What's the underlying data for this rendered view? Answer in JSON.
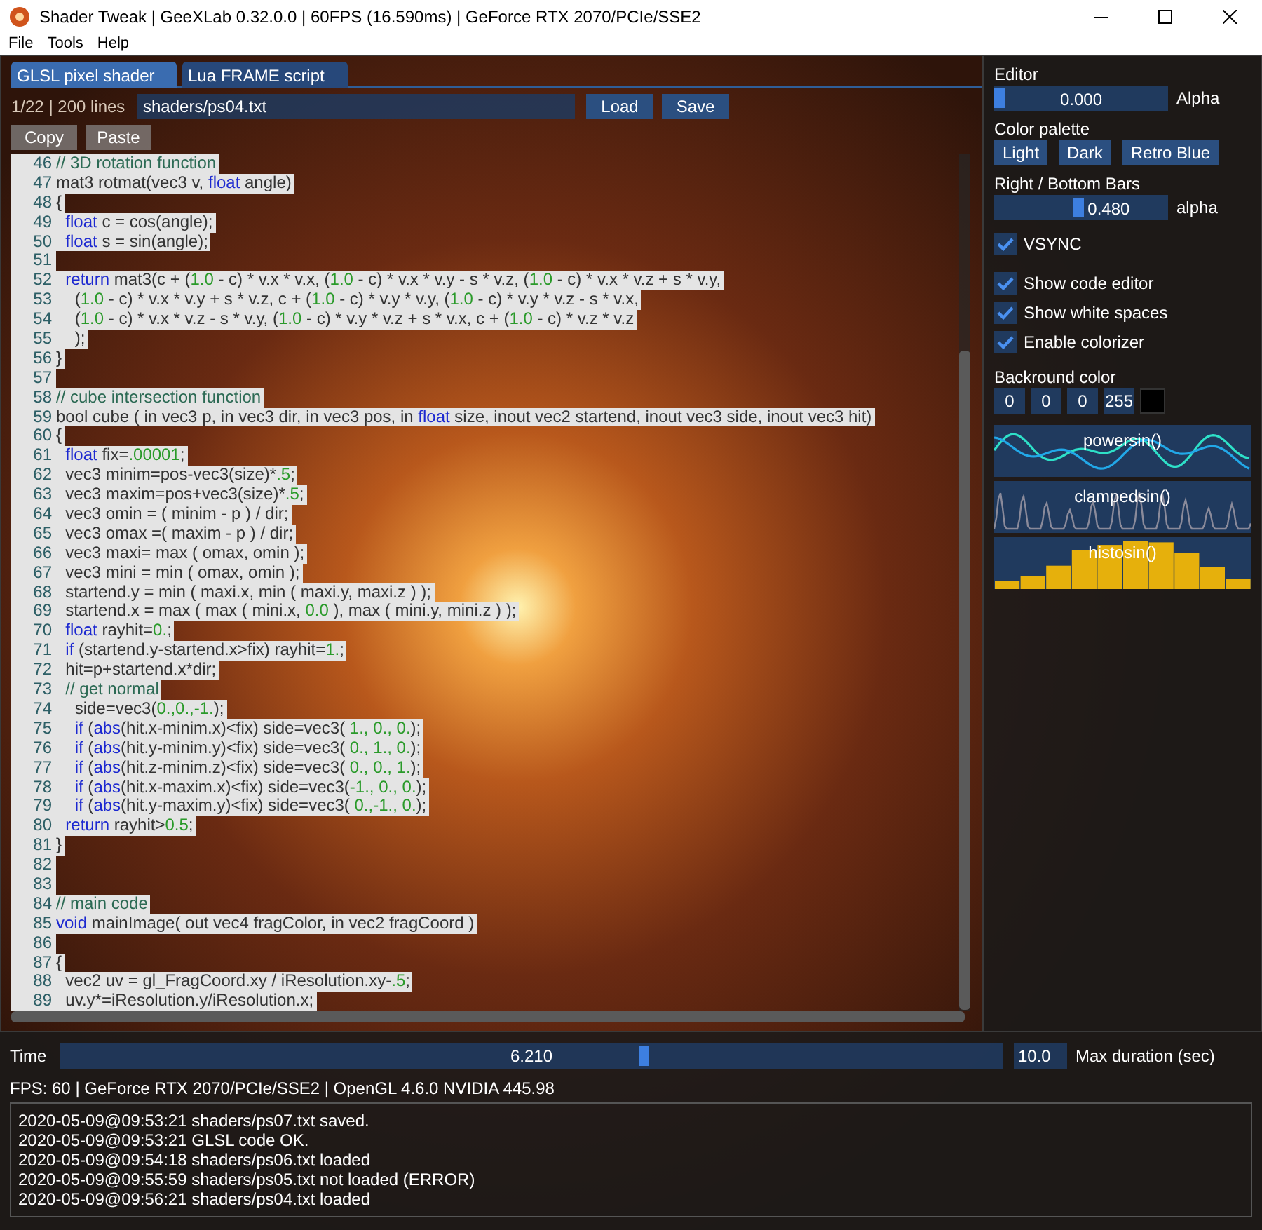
{
  "window": {
    "title": "Shader Tweak | GeeXLab 0.32.0.0 | 60FPS (16.590ms) | GeForce RTX 2070/PCIe/SSE2"
  },
  "menu": [
    "File",
    "Tools",
    "Help"
  ],
  "tabs": [
    {
      "label": "GLSL pixel shader",
      "selected": true
    },
    {
      "label": "Lua FRAME script",
      "selected": false
    }
  ],
  "editor": {
    "info": "1/22 | 200 lines",
    "path": "shaders/ps04.txt",
    "buttons": [
      "Load",
      "Save"
    ],
    "clipboard_buttons": [
      "Copy",
      "Paste"
    ],
    "lines": [
      {
        "n": "46",
        "parts": [
          {
            "t": "// 3D rotation function",
            "kind": "comment"
          }
        ]
      },
      {
        "n": "47",
        "parts": [
          {
            "t": "mat3 rotmat(vec3 v, "
          },
          {
            "t": "float",
            "kind": "keyword"
          },
          {
            "t": " angle)"
          }
        ]
      },
      {
        "n": "48",
        "parts": [
          {
            "t": "{"
          }
        ]
      },
      {
        "n": "49",
        "parts": [
          {
            "t": "  float",
            "kind": "keyword"
          },
          {
            "t": " c = cos(angle);"
          }
        ]
      },
      {
        "n": "50",
        "parts": [
          {
            "t": "  float",
            "kind": "keyword"
          },
          {
            "t": " s = sin(angle);"
          }
        ]
      },
      {
        "n": "51"
      },
      {
        "n": "52",
        "parts": [
          {
            "t": "  return",
            "kind": "keyword"
          },
          {
            "t": " mat3(c + ("
          },
          {
            "t": "1.0",
            "kind": "number"
          },
          {
            "t": " - c) * v.x * v.x, ("
          },
          {
            "t": "1.0",
            "kind": "number"
          },
          {
            "t": " - c) * v.x * v.y - s * v.z, ("
          },
          {
            "t": "1.0",
            "kind": "number"
          },
          {
            "t": " - c) * v.x * v.z + s * v.y,"
          }
        ]
      },
      {
        "n": "53",
        "parts": [
          {
            "t": "    ("
          },
          {
            "t": "1.0",
            "kind": "number"
          },
          {
            "t": " - c) * v.x * v.y + s * v.z, c + ("
          },
          {
            "t": "1.0",
            "kind": "number"
          },
          {
            "t": " - c) * v.y * v.y, ("
          },
          {
            "t": "1.0",
            "kind": "number"
          },
          {
            "t": " - c) * v.y * v.z - s * v.x,"
          }
        ]
      },
      {
        "n": "54",
        "parts": [
          {
            "t": "    ("
          },
          {
            "t": "1.0",
            "kind": "number"
          },
          {
            "t": " - c) * v.x * v.z - s * v.y, ("
          },
          {
            "t": "1.0",
            "kind": "number"
          },
          {
            "t": " - c) * v.y * v.z + s * v.x, c + ("
          },
          {
            "t": "1.0",
            "kind": "number"
          },
          {
            "t": " - c) * v.z * v.z"
          }
        ]
      },
      {
        "n": "55",
        "parts": [
          {
            "t": "    );"
          }
        ]
      },
      {
        "n": "56",
        "parts": [
          {
            "t": "}"
          }
        ]
      },
      {
        "n": "57"
      },
      {
        "n": "58",
        "parts": [
          {
            "t": "// cube intersection function",
            "kind": "comment"
          }
        ]
      },
      {
        "n": "59",
        "parts": [
          {
            "t": "bool cube ( in vec3 p, in vec3 dir, in vec3 pos, in "
          },
          {
            "t": "float",
            "kind": "keyword"
          },
          {
            "t": " size, inout vec2 startend, inout vec3 side, inout vec3 hit)"
          }
        ]
      },
      {
        "n": "60",
        "parts": [
          {
            "t": "{"
          }
        ]
      },
      {
        "n": "61",
        "parts": [
          {
            "t": "  float",
            "kind": "keyword"
          },
          {
            "t": " fix="
          },
          {
            "t": ".00001",
            "kind": "number"
          },
          {
            "t": ";"
          }
        ]
      },
      {
        "n": "62",
        "parts": [
          {
            "t": "  vec3 minim=pos-vec3(size)*"
          },
          {
            "t": ".5",
            "kind": "number"
          },
          {
            "t": ";"
          }
        ]
      },
      {
        "n": "63",
        "parts": [
          {
            "t": "  vec3 maxim=pos+vec3(size)*"
          },
          {
            "t": ".5",
            "kind": "number"
          },
          {
            "t": ";"
          }
        ]
      },
      {
        "n": "64",
        "parts": [
          {
            "t": "  vec3 omin = ( minim - p ) / dir;"
          }
        ]
      },
      {
        "n": "65",
        "parts": [
          {
            "t": "  vec3 omax =( maxim - p ) / dir;"
          }
        ]
      },
      {
        "n": "66",
        "parts": [
          {
            "t": "  vec3 maxi= max ( omax, omin );"
          }
        ]
      },
      {
        "n": "67",
        "parts": [
          {
            "t": "  vec3 mini = min ( omax, omin );"
          }
        ]
      },
      {
        "n": "68",
        "parts": [
          {
            "t": "  startend.y = min ( maxi.x, min ( maxi.y, maxi.z ) );"
          }
        ]
      },
      {
        "n": "69",
        "parts": [
          {
            "t": "  startend.x = max ( max ( mini.x, "
          },
          {
            "t": "0.0",
            "kind": "number"
          },
          {
            "t": " ), max ( mini.y, mini.z ) );"
          }
        ]
      },
      {
        "n": "70",
        "parts": [
          {
            "t": "  float",
            "kind": "keyword"
          },
          {
            "t": " rayhit="
          },
          {
            "t": "0.",
            "kind": "number"
          },
          {
            "t": ";"
          }
        ]
      },
      {
        "n": "71",
        "parts": [
          {
            "t": "  if",
            "kind": "keyword"
          },
          {
            "t": " (startend.y-startend.x>fix) rayhit="
          },
          {
            "t": "1.",
            "kind": "number"
          },
          {
            "t": ";"
          }
        ]
      },
      {
        "n": "72",
        "parts": [
          {
            "t": "  hit=p+startend.x*dir;"
          }
        ]
      },
      {
        "n": "73",
        "parts": [
          {
            "t": "  // get normal",
            "kind": "comment"
          }
        ]
      },
      {
        "n": "74",
        "parts": [
          {
            "t": "    side=vec3("
          },
          {
            "t": "0.,0.,-1.",
            "kind": "number"
          },
          {
            "t": ");"
          }
        ]
      },
      {
        "n": "75",
        "parts": [
          {
            "t": "    if",
            "kind": "keyword"
          },
          {
            "t": " ("
          },
          {
            "t": "abs",
            "kind": "keyword"
          },
          {
            "t": "(hit.x-minim.x)<fix) side=vec3( "
          },
          {
            "t": "1., 0., 0.",
            "kind": "number"
          },
          {
            "t": ");"
          }
        ]
      },
      {
        "n": "76",
        "parts": [
          {
            "t": "    if",
            "kind": "keyword"
          },
          {
            "t": " ("
          },
          {
            "t": "abs",
            "kind": "keyword"
          },
          {
            "t": "(hit.y-minim.y)<fix) side=vec3( "
          },
          {
            "t": "0., 1., 0.",
            "kind": "number"
          },
          {
            "t": ");"
          }
        ]
      },
      {
        "n": "77",
        "parts": [
          {
            "t": "    if",
            "kind": "keyword"
          },
          {
            "t": " ("
          },
          {
            "t": "abs",
            "kind": "keyword"
          },
          {
            "t": "(hit.z-minim.z)<fix) side=vec3( "
          },
          {
            "t": "0., 0., 1.",
            "kind": "number"
          },
          {
            "t": ");"
          }
        ]
      },
      {
        "n": "78",
        "parts": [
          {
            "t": "    if",
            "kind": "keyword"
          },
          {
            "t": " ("
          },
          {
            "t": "abs",
            "kind": "keyword"
          },
          {
            "t": "(hit.x-maxim.x)<fix) side=vec3("
          },
          {
            "t": "-1., 0., 0.",
            "kind": "number"
          },
          {
            "t": ");"
          }
        ]
      },
      {
        "n": "79",
        "parts": [
          {
            "t": "    if",
            "kind": "keyword"
          },
          {
            "t": " ("
          },
          {
            "t": "abs",
            "kind": "keyword"
          },
          {
            "t": "(hit.y-maxim.y)<fix) side=vec3( "
          },
          {
            "t": "0.,-1., 0.",
            "kind": "number"
          },
          {
            "t": ");"
          }
        ]
      },
      {
        "n": "80",
        "parts": [
          {
            "t": "  return",
            "kind": "keyword"
          },
          {
            "t": " rayhit>"
          },
          {
            "t": "0.5",
            "kind": "number"
          },
          {
            "t": ";"
          }
        ]
      },
      {
        "n": "81",
        "parts": [
          {
            "t": "}"
          }
        ]
      },
      {
        "n": "82"
      },
      {
        "n": "83"
      },
      {
        "n": "84",
        "parts": [
          {
            "t": "// main code",
            "kind": "comment"
          }
        ]
      },
      {
        "n": "85",
        "parts": [
          {
            "t": "void",
            "kind": "keyword"
          },
          {
            "t": " mainImage( out vec4 fragColor, in vec2 fragCoord )"
          }
        ]
      },
      {
        "n": "86"
      },
      {
        "n": "87",
        "parts": [
          {
            "t": "{"
          }
        ]
      },
      {
        "n": "88",
        "parts": [
          {
            "t": "  vec2 uv = gl_FragCoord.xy / iResolution.xy-"
          },
          {
            "t": ".5",
            "kind": "number"
          },
          {
            "t": ";"
          }
        ]
      },
      {
        "n": "89",
        "parts": [
          {
            "t": "  uv.y*=iResolution.y/iResolution.x;"
          }
        ]
      }
    ]
  },
  "settings": {
    "editor": {
      "heading": "Editor",
      "value": "0.000",
      "level": 0,
      "label": "Alpha"
    },
    "palette": {
      "heading": "Color palette",
      "buttons": [
        "Light",
        "Dark",
        "Retro Blue"
      ]
    },
    "bars": {
      "heading": "Right / Bottom Bars",
      "value": "0.480",
      "level": 0.48,
      "label": "alpha"
    },
    "checkboxes": [
      {
        "label": "VSYNC",
        "checked": true
      },
      {
        "label": "Show code editor",
        "checked": true
      },
      {
        "label": "Show white spaces",
        "checked": true
      },
      {
        "label": "Enable colorizer",
        "checked": true
      }
    ],
    "background": {
      "heading": "Backround color",
      "values": [
        "0",
        "0",
        "0",
        "255"
      ],
      "color": "#000000"
    },
    "plots": [
      {
        "label": "powersin()",
        "kind": "waves"
      },
      {
        "label": "clampedsin()",
        "kind": "pulses"
      },
      {
        "label": "histosin()",
        "kind": "histogram"
      }
    ]
  },
  "timeline": {
    "label": "Time",
    "value": "6.210",
    "level": 0.621,
    "max": "10.0",
    "max_label": "Max duration (sec)"
  },
  "status": "FPS: 60 | GeForce RTX 2070/PCIe/SSE2 | OpenGL 4.6.0 NVIDIA 445.98",
  "log": [
    "2020-05-09@09:53:21 shaders/ps07.txt saved.",
    "2020-05-09@09:53:21 GLSL code OK.",
    "2020-05-09@09:54:18 shaders/ps06.txt loaded",
    "2020-05-09@09:55:59 shaders/ps05.txt not loaded (ERROR)",
    "2020-05-09@09:56:21 shaders/ps04.txt loaded"
  ]
}
